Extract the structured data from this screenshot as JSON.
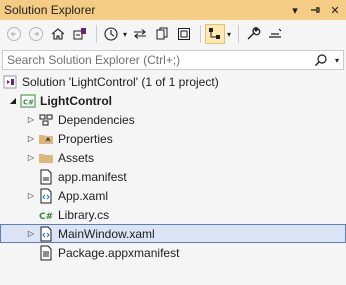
{
  "title_bar": {
    "title": "Solution Explorer",
    "actions": {
      "dropdown": "▾",
      "pin": "⊣",
      "close": "✕"
    }
  },
  "search": {
    "placeholder": "Search Solution Explorer (Ctrl+;)"
  },
  "tree": {
    "solution": "Solution 'LightControl' (1 of 1 project)",
    "project": "LightControl",
    "items": [
      {
        "label": "Dependencies",
        "icon": "dependencies-icon"
      },
      {
        "label": "Properties",
        "icon": "properties-folder-icon"
      },
      {
        "label": "Assets",
        "icon": "folder-icon"
      },
      {
        "label": "app.manifest",
        "icon": "manifest-file-icon"
      },
      {
        "label": "App.xaml",
        "icon": "xaml-file-icon"
      },
      {
        "label": "Library.cs",
        "icon": "csharp-file-icon"
      },
      {
        "label": "MainWindow.xaml",
        "icon": "xaml-file-icon"
      },
      {
        "label": "Package.appxmanifest",
        "icon": "appxmanifest-file-icon"
      }
    ]
  },
  "colors": {
    "title_bar_bg": "#f5cc84",
    "selection_bg": "#dbe4f5",
    "selection_border": "#5a7ec3",
    "csharp_green": "#388a34",
    "folder_yellow": "#dcb67a"
  }
}
